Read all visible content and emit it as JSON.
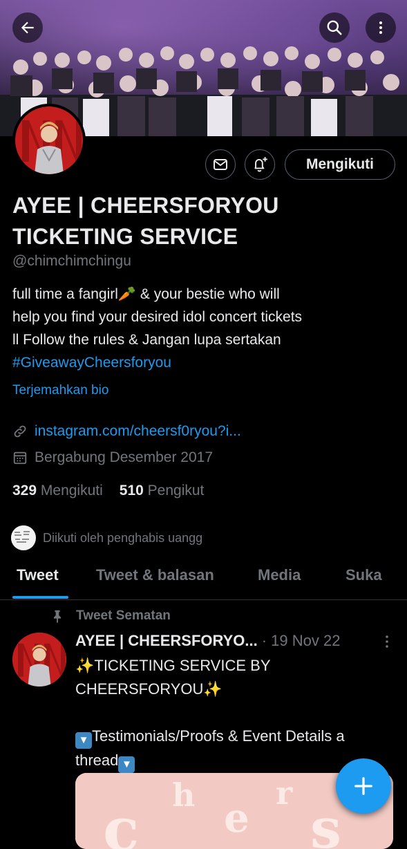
{
  "header": {
    "back_icon": "arrow-left-icon",
    "search_icon": "search-icon",
    "more_icon": "more-vertical-icon"
  },
  "actions": {
    "message_icon": "mail-icon",
    "notify_icon": "bell-plus-icon",
    "follow_label": "Mengikuti"
  },
  "profile": {
    "name_line1": "AYEE | CHEERSFORYOU",
    "name_line2": "TICKETING SERVICE",
    "handle": "@chimchimchingu",
    "bio_line1": "full time a fangirl🥕 & your bestie who will",
    "bio_line2": "help you find your desired idol concert tickets",
    "bio_line3": "ll Follow the rules & Jangan lupa sertakan",
    "bio_hashtag": "#GiveawayCheersforyou",
    "translate_label": "Terjemahkan bio",
    "link": "instagram.com/cheersf0ryou?i...",
    "joined": "Bergabung Desember 2017",
    "following_count": "329",
    "following_label": "Mengikuti",
    "followers_count": "510",
    "followers_label": "Pengikut",
    "followed_by": "Diikuti oleh penghabis uangg"
  },
  "tabs": [
    {
      "label": "Tweet",
      "active": true
    },
    {
      "label": "Tweet & balasan",
      "active": false
    },
    {
      "label": "Media",
      "active": false
    },
    {
      "label": "Suka",
      "active": false
    }
  ],
  "tweet": {
    "pinned_label": "Tweet Sematan",
    "author": "AYEE | CHEERSFORYO...",
    "date": "· 19 Nov 22",
    "line1": "✨TICKETING SERVICE BY",
    "line2": "CHEERSFORYOU✨",
    "line3": "Testimonials/Proofs & Event Details a",
    "line4": "thread",
    "media_text": "cheers"
  },
  "fab": {
    "icon": "plus-icon"
  },
  "colors": {
    "accent": "#1d9bf0",
    "background": "#000000",
    "muted": "#71767b",
    "text": "#e7e9ea"
  }
}
